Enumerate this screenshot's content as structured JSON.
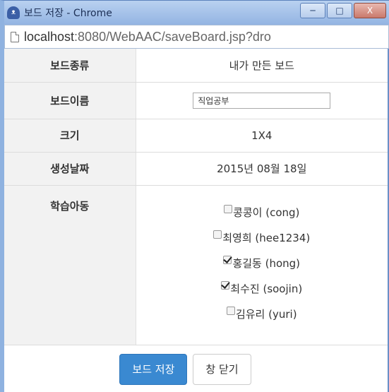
{
  "window": {
    "title": "보드 저장 - Chrome",
    "minimize": "─",
    "maximize": "□",
    "close": "X"
  },
  "address": {
    "host": "localhost",
    "rest": ":8080/WebAAC/saveBoard.jsp?dro"
  },
  "form": {
    "board_type_label": "보드종류",
    "board_type_value": "내가 만든 보드",
    "board_name_label": "보드이름",
    "board_name_value": "직업공부",
    "size_label": "크기",
    "size_value": "1X4",
    "created_label": "생성날짜",
    "created_value": "2015년 08월 18일",
    "students_label": "학습아동",
    "students": [
      {
        "label": "콩콩이 (cong)",
        "checked": false
      },
      {
        "label": "최영희 (hee1234)",
        "checked": false
      },
      {
        "label": "홍길동 (hong)",
        "checked": true
      },
      {
        "label": "최수진 (soojin)",
        "checked": true
      },
      {
        "label": "김유리 (yuri)",
        "checked": false
      }
    ]
  },
  "buttons": {
    "save": "보드 저장",
    "close": "창 닫기"
  }
}
